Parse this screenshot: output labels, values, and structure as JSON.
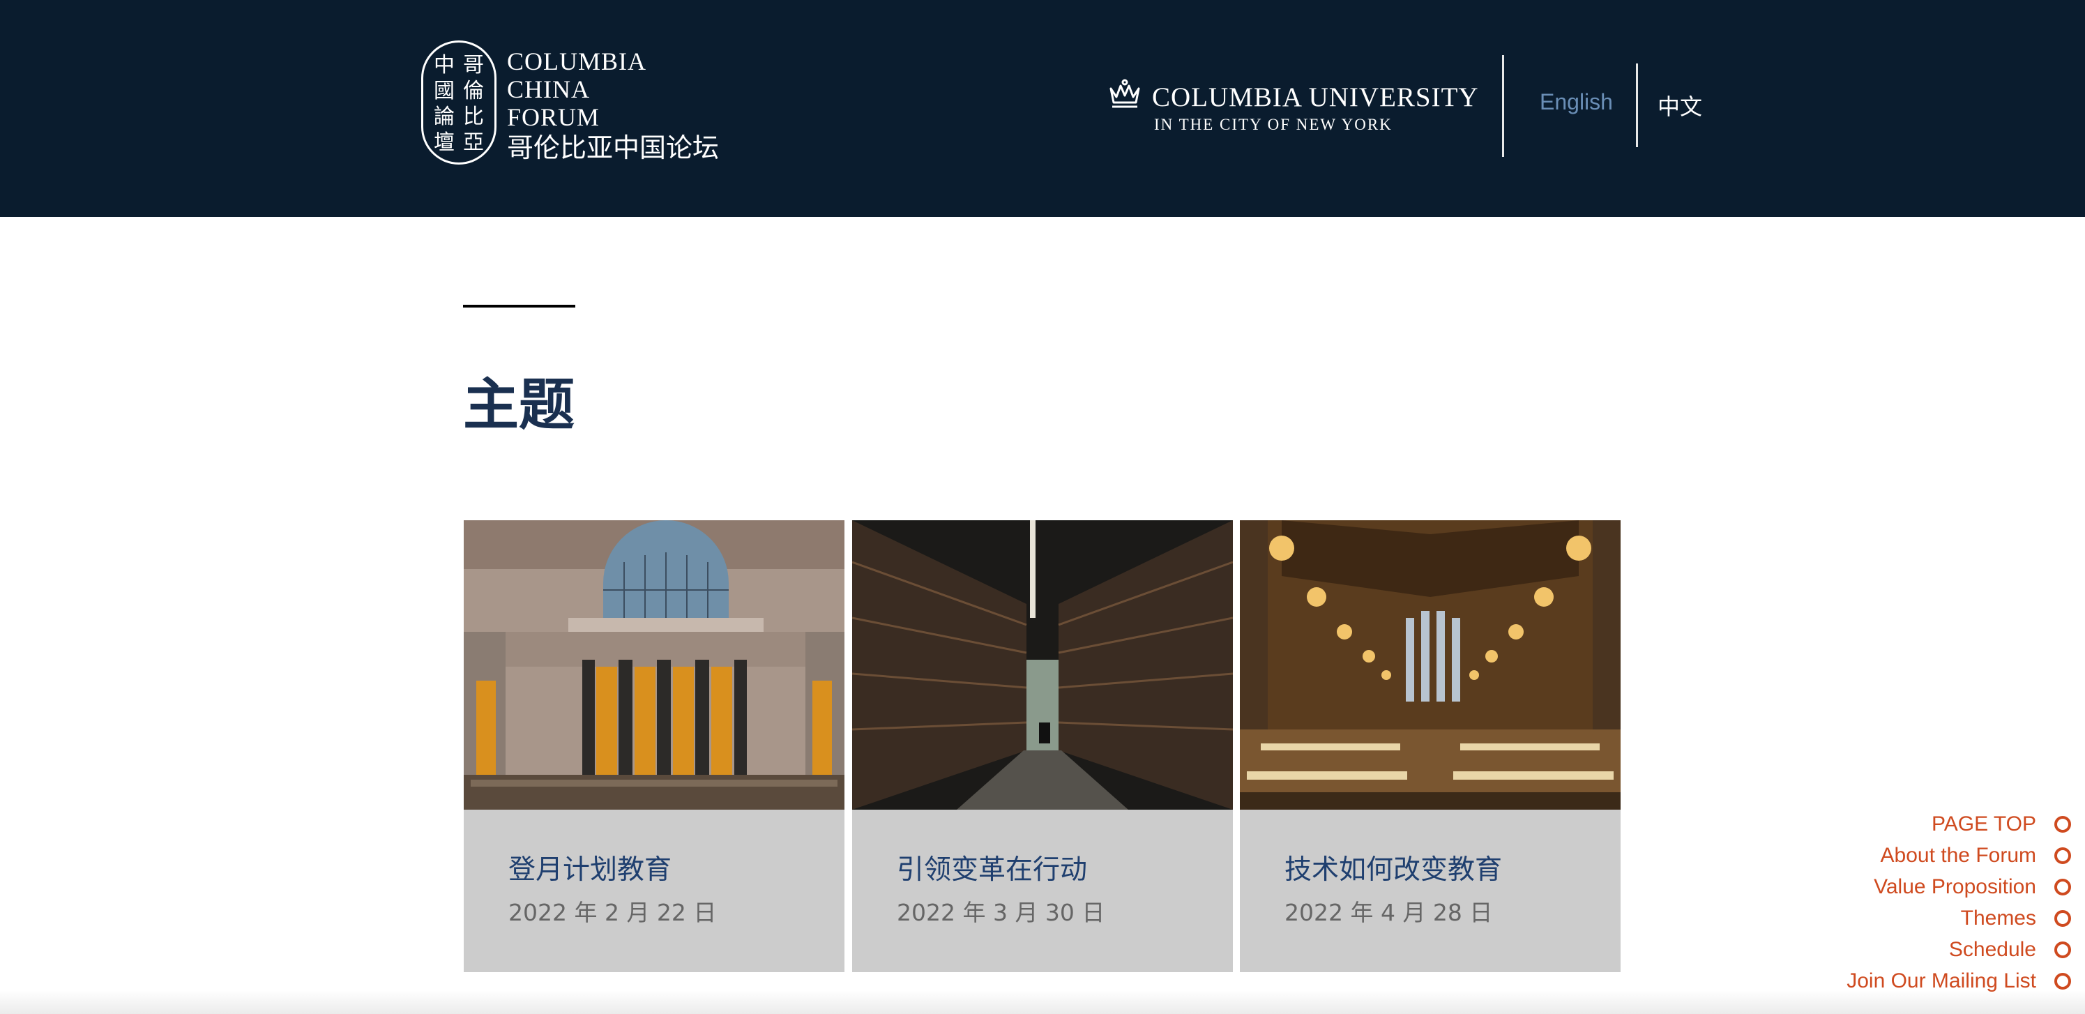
{
  "header": {
    "seal_chars_right": [
      "哥",
      "倫",
      "比",
      "亞"
    ],
    "seal_chars_left": [
      "中",
      "國",
      "論",
      "壇"
    ],
    "forum_name_en": [
      "COLUMBIA",
      "CHINA",
      "FORUM"
    ],
    "forum_name_zh": "哥伦比亚中国论坛",
    "university_name": "COLUMBIA UNIVERSITY",
    "university_sub": "IN THE CITY OF NEW YORK",
    "lang_english": "English",
    "lang_chinese": "中文"
  },
  "main": {
    "section_title": "主题",
    "cards": [
      {
        "title": "登月计划教育",
        "date": "2022 年 2 月 22 日",
        "image": "library-hall-photo"
      },
      {
        "title": "引领变革在行动",
        "date": "2022 年 3 月 30 日",
        "image": "book-stacks-photo"
      },
      {
        "title": "技术如何改变教育",
        "date": "2022 年 4 月 28 日",
        "image": "reading-room-photo"
      }
    ]
  },
  "sidenav": {
    "items": [
      "PAGE TOP",
      "About the Forum",
      "Value Proposition",
      "Themes",
      "Schedule",
      "Join Our Mailing List"
    ]
  },
  "colors": {
    "header_bg": "#0a1c2e",
    "accent": "#cf4a1f",
    "card_bg": "#cccccc",
    "card_title": "#1f3f6f",
    "lang_english": "#6a8eb6"
  }
}
